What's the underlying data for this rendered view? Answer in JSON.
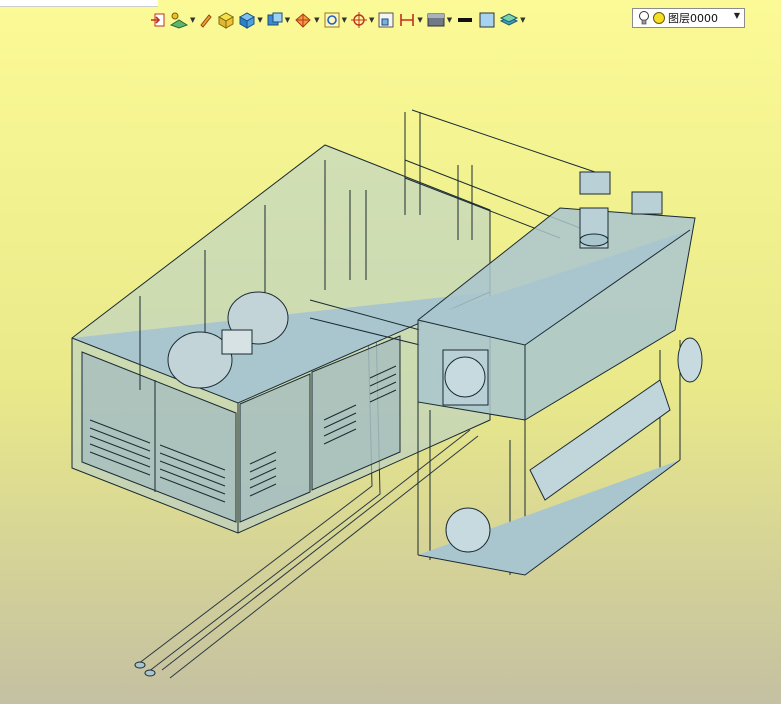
{
  "toolbar": {
    "items": [
      {
        "icon": "exit-icon"
      },
      {
        "icon": "sketch-icon",
        "dropdown": true
      },
      {
        "icon": "pencil-icon"
      },
      {
        "icon": "cube-yellow-icon"
      },
      {
        "icon": "cube-blue-icon",
        "dropdown": true
      },
      {
        "icon": "cube-view-icon",
        "dropdown": true
      },
      {
        "icon": "sphere-icon",
        "dropdown": true
      },
      {
        "icon": "zoom-icon",
        "dropdown": true
      },
      {
        "icon": "target-icon",
        "dropdown": true
      },
      {
        "icon": "frame-icon"
      },
      {
        "icon": "dimension-icon",
        "dropdown": true
      },
      {
        "icon": "display-mode-icon",
        "dropdown": true
      },
      {
        "icon": "line-color-icon"
      },
      {
        "icon": "fill-color-icon"
      },
      {
        "icon": "layers-icon",
        "dropdown": true
      }
    ]
  },
  "layer": {
    "value": "图层0000",
    "bulb_icon": "lightbulb-icon",
    "status_icon": "layer-circle-icon"
  },
  "colors": {
    "bg_top": "#fbfa96",
    "bg_bottom": "#c4c0a2",
    "model_fill": "#a9c6cf",
    "model_edge": "#1b2b33"
  }
}
